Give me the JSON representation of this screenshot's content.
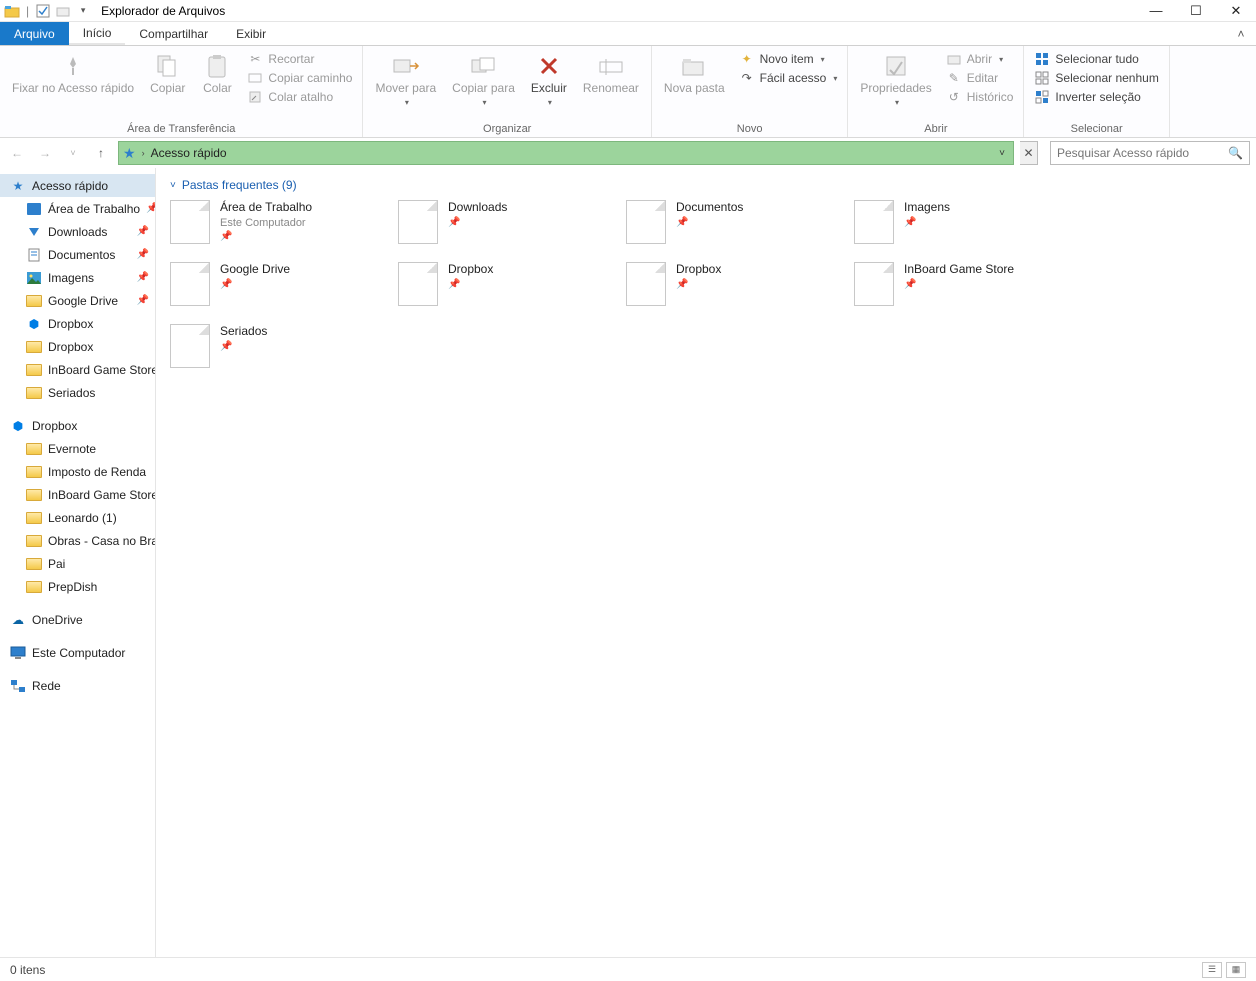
{
  "window": {
    "title": "Explorador de Arquivos"
  },
  "tabs": {
    "file": "Arquivo",
    "home": "Início",
    "share": "Compartilhar",
    "view": "Exibir"
  },
  "ribbon": {
    "clipboard": {
      "pin": "Fixar no Acesso rápido",
      "copy": "Copiar",
      "paste": "Colar",
      "cut": "Recortar",
      "copy_path": "Copiar caminho",
      "paste_shortcut": "Colar atalho",
      "label": "Área de Transferência"
    },
    "organize": {
      "move_to": "Mover para",
      "copy_to": "Copiar para",
      "delete": "Excluir",
      "rename": "Renomear",
      "label": "Organizar"
    },
    "new": {
      "new_folder": "Nova pasta",
      "new_item": "Novo item",
      "easy_access": "Fácil acesso",
      "label": "Novo"
    },
    "open": {
      "properties": "Propriedades",
      "open": "Abrir",
      "edit": "Editar",
      "history": "Histórico",
      "label": "Abrir"
    },
    "select": {
      "select_all": "Selecionar tudo",
      "select_none": "Selecionar nenhum",
      "invert": "Inverter seleção",
      "label": "Selecionar"
    }
  },
  "address": {
    "location": "Acesso rápido"
  },
  "search": {
    "placeholder": "Pesquisar Acesso rápido"
  },
  "tree": {
    "quick_access": "Acesso rápido",
    "qa_items": [
      {
        "label": "Área de Trabalho",
        "icon": "desktop",
        "pin": true
      },
      {
        "label": "Downloads",
        "icon": "download",
        "pin": true
      },
      {
        "label": "Documentos",
        "icon": "doc",
        "pin": true
      },
      {
        "label": "Imagens",
        "icon": "img",
        "pin": true
      },
      {
        "label": "Google Drive",
        "icon": "folder",
        "pin": true
      },
      {
        "label": "Dropbox",
        "icon": "dropbox",
        "pin": false
      },
      {
        "label": "Dropbox",
        "icon": "folder",
        "pin": false
      },
      {
        "label": "InBoard Game Store",
        "icon": "folder",
        "pin": false
      },
      {
        "label": "Seriados",
        "icon": "folder",
        "pin": false
      }
    ],
    "dropbox": "Dropbox",
    "db_items": [
      {
        "label": "Evernote"
      },
      {
        "label": "Imposto de Renda"
      },
      {
        "label": "InBoard Game Store"
      },
      {
        "label": "Leonardo (1)"
      },
      {
        "label": "Obras - Casa no Bra"
      },
      {
        "label": "Pai"
      },
      {
        "label": "PrepDish"
      }
    ],
    "onedrive": "OneDrive",
    "this_pc": "Este Computador",
    "network": "Rede"
  },
  "content": {
    "section_title": "Pastas frequentes (9)",
    "tiles": [
      {
        "name": "Área de Trabalho",
        "sub": "Este Computador"
      },
      {
        "name": "Downloads",
        "sub": ""
      },
      {
        "name": "Documentos",
        "sub": ""
      },
      {
        "name": "Imagens",
        "sub": ""
      },
      {
        "name": "Google Drive",
        "sub": ""
      },
      {
        "name": "Dropbox",
        "sub": ""
      },
      {
        "name": "Dropbox",
        "sub": ""
      },
      {
        "name": "InBoard Game Store",
        "sub": ""
      },
      {
        "name": "Seriados",
        "sub": ""
      }
    ]
  },
  "status": {
    "items": "0 itens"
  }
}
